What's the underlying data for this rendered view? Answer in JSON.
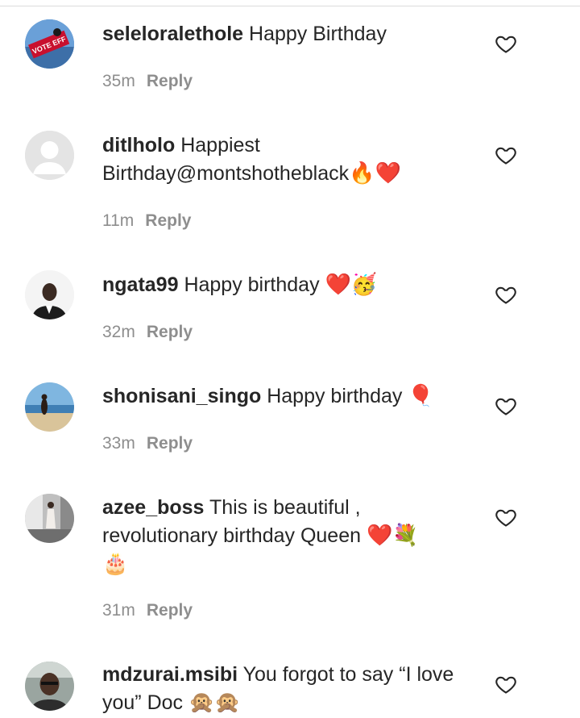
{
  "comments": [
    {
      "username": "seleloralethole",
      "text": "Happy Birthday",
      "emoji": "",
      "emoji2": "",
      "time": "35m",
      "reply": "Reply",
      "avatar_icon": "vote-eff-avatar",
      "avatar_text": "VOTE EFF"
    },
    {
      "username": "ditlholo",
      "text": "Happiest Birthday@montshotheblack",
      "emoji": "🔥❤️",
      "emoji2": "",
      "time": "11m",
      "reply": "Reply",
      "avatar_icon": "default-user-avatar"
    },
    {
      "username": "ngata99",
      "text": "Happy birthday",
      "emoji": "❤️🥳",
      "emoji2": "",
      "time": "32m",
      "reply": "Reply",
      "avatar_icon": "man-in-suit-avatar"
    },
    {
      "username": "shonisani_singo",
      "text": "Happy birthday",
      "emoji": "🎈",
      "emoji2": "",
      "time": "33m",
      "reply": "Reply",
      "avatar_icon": "beach-avatar"
    },
    {
      "username": "azee_boss",
      "text": "This is beautiful , revolutionary birthday Queen",
      "emoji": "❤️💐",
      "emoji2": "🎂",
      "time": "31m",
      "reply": "Reply",
      "avatar_icon": "woman-standing-avatar"
    },
    {
      "username": "mdzurai.msibi",
      "text": "You forgot to say “I love you” Doc",
      "emoji": "🙊🙊",
      "emoji2": "",
      "time": "",
      "reply": "",
      "avatar_icon": "man-portrait-avatar"
    }
  ],
  "colors": {
    "text": "#262626",
    "meta": "#8e8e8e",
    "heart_stroke": "#262626"
  }
}
